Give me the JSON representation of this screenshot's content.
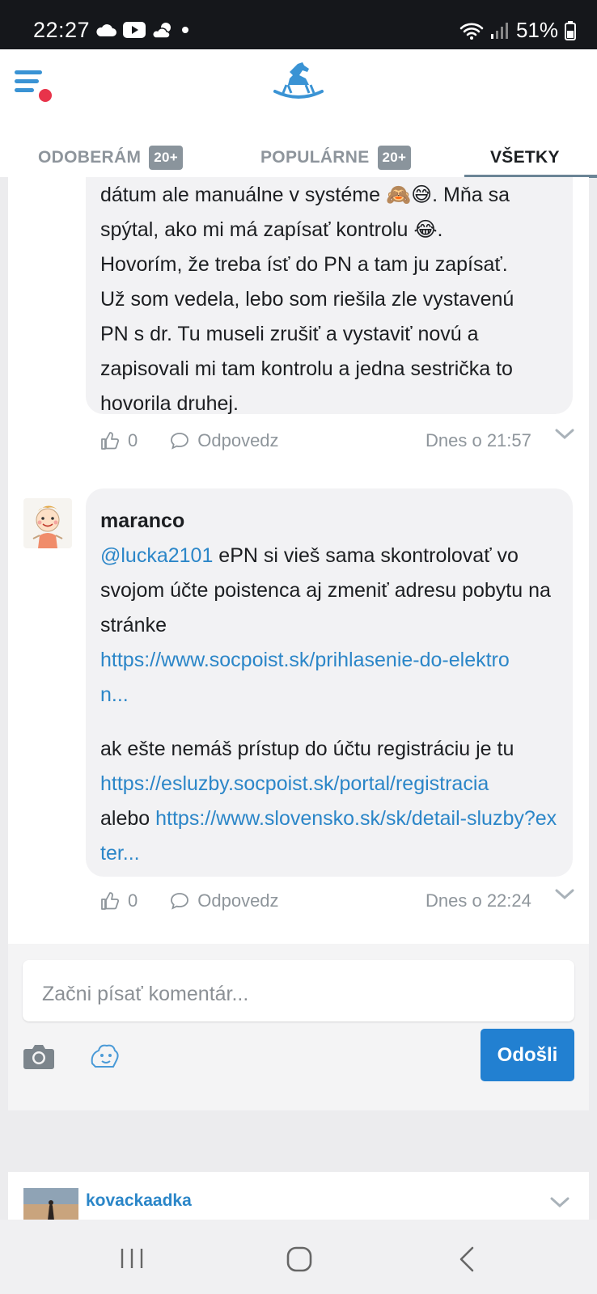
{
  "status": {
    "time": "22:27",
    "battery": "51%"
  },
  "tabs": [
    {
      "label": "ODOBERÁM",
      "badge": "20+"
    },
    {
      "label": "POPULÁRNE",
      "badge": "20+"
    },
    {
      "label": "VŠETKY"
    }
  ],
  "comment1": {
    "lines": [
      "dátum ale manuálne v systéme 🙈😅. Mňa sa",
      "spýtal, ako mi má zapísať kontrolu 😂.",
      "Hovorím, že treba ísť do PN a tam ju zapísať.",
      "Už som vedela, lebo som riešila zle vystavenú",
      "PN s dr. Tu museli zrušiť a vystaviť novú a",
      "zapisovali mi tam kontrolu a jedna sestrička to",
      "hovorila druhej."
    ],
    "likes": "0",
    "reply_label": "Odpovedz",
    "time": "Dnes o 21:57"
  },
  "comment2": {
    "author": "maranco",
    "mention": "@lucka2101",
    "text1": " ePN si vieš sama skontrolovať vo svojom účte poistenca aj zmeniť adresu pobytu na stránke",
    "link1": "https://www.socpoist.sk/prihlasenie-do-elektron...",
    "text2": "ak ešte nemáš prístup do účtu registráciu je tu",
    "link2": "https://esluzby.socpoist.sk/portal/registracia",
    "text3": "alebo",
    "link3": "https://www.slovensko.sk/sk/detail-sluzby?exter...",
    "likes": "0",
    "reply_label": "Odpovedz",
    "time": "Dnes o 22:24"
  },
  "composer": {
    "placeholder": "Začni písať komentár...",
    "send_label": "Odošli"
  },
  "next_post": {
    "author": "kovackaadka"
  },
  "colors": {
    "accent": "#2280d1",
    "link": "#2b86c8",
    "notification_dot": "#e8334a"
  }
}
